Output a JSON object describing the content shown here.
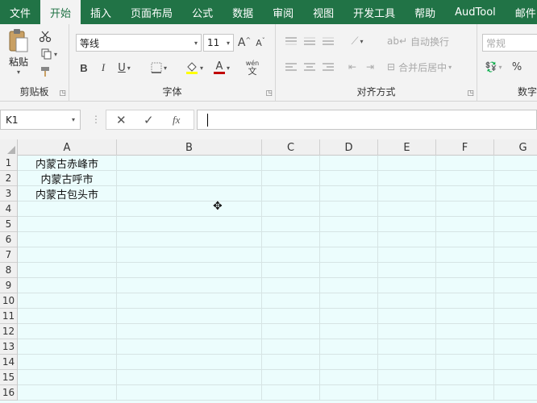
{
  "tabs": [
    "文件",
    "开始",
    "插入",
    "页面布局",
    "公式",
    "数据",
    "审阅",
    "视图",
    "开发工具",
    "帮助",
    "AudTool",
    "邮件"
  ],
  "active_tab": "开始",
  "clipboard": {
    "paste_label": "粘贴",
    "group_label": "剪贴板"
  },
  "font": {
    "name": "等线",
    "size": "11",
    "group_label": "字体",
    "bold": "B",
    "italic": "I",
    "underline": "U",
    "grow": "A",
    "shrink": "A",
    "font_color": "A",
    "phonetic": "wén"
  },
  "alignment": {
    "wrap_label": "自动换行",
    "merge_label": "合并后居中",
    "group_label": "对齐方式"
  },
  "number": {
    "format": "常规",
    "percent": "%",
    "group_label": "数字"
  },
  "formula_bar": {
    "name_box": "K1",
    "cancel": "✕",
    "enter": "✓",
    "fx": "fx",
    "value": ""
  },
  "columns": [
    "A",
    "B",
    "C",
    "D",
    "E",
    "F",
    "G"
  ],
  "rows": [
    "1",
    "2",
    "3",
    "4",
    "5",
    "6",
    "7",
    "8",
    "9",
    "10",
    "11",
    "12",
    "13",
    "14",
    "15",
    "16"
  ],
  "cells": {
    "A1": "内蒙古赤峰市",
    "A2": "内蒙古呼市",
    "A3": "内蒙古包头市"
  }
}
